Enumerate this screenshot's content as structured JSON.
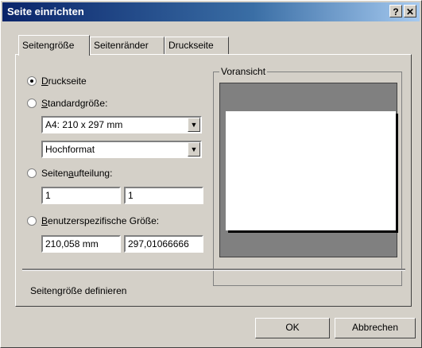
{
  "window": {
    "title": "Seite einrichten",
    "help_glyph": "?",
    "close_glyph": "✕"
  },
  "tabs": [
    {
      "label": "Seitengröße",
      "active": true
    },
    {
      "label": "Seitenränder",
      "active": false
    },
    {
      "label": "Druckseite",
      "active": false
    }
  ],
  "options": {
    "print_page": {
      "label_pre": "",
      "label_u": "D",
      "label_post": "ruckseite",
      "selected": true
    },
    "standard_size": {
      "label_pre": "",
      "label_u": "S",
      "label_post": "tandardgröße:",
      "selected": false
    },
    "paper_select": {
      "value": "A4: 210  x  297 mm"
    },
    "orientation_select": {
      "value": "Hochformat"
    },
    "tiling": {
      "label_pre": "Seiten",
      "label_u": "a",
      "label_post": "ufteilung:",
      "selected": false
    },
    "tiling_x": {
      "value": "1"
    },
    "tiling_y": {
      "value": "1"
    },
    "custom": {
      "label_pre": "",
      "label_u": "B",
      "label_post": "enutzerspezifische Größe:",
      "selected": false
    },
    "custom_width": {
      "value": "210,058 mm"
    },
    "custom_height": {
      "value": "297,01066666"
    }
  },
  "preview": {
    "label": "Voransicht"
  },
  "status_text": "Seitengröße definieren",
  "buttons": {
    "ok": "OK",
    "cancel": "Abbrechen"
  },
  "colors": {
    "title_start": "#0a246a",
    "title_end": "#a6caf0",
    "face": "#d4d0c8",
    "preview_bg": "#808080"
  }
}
